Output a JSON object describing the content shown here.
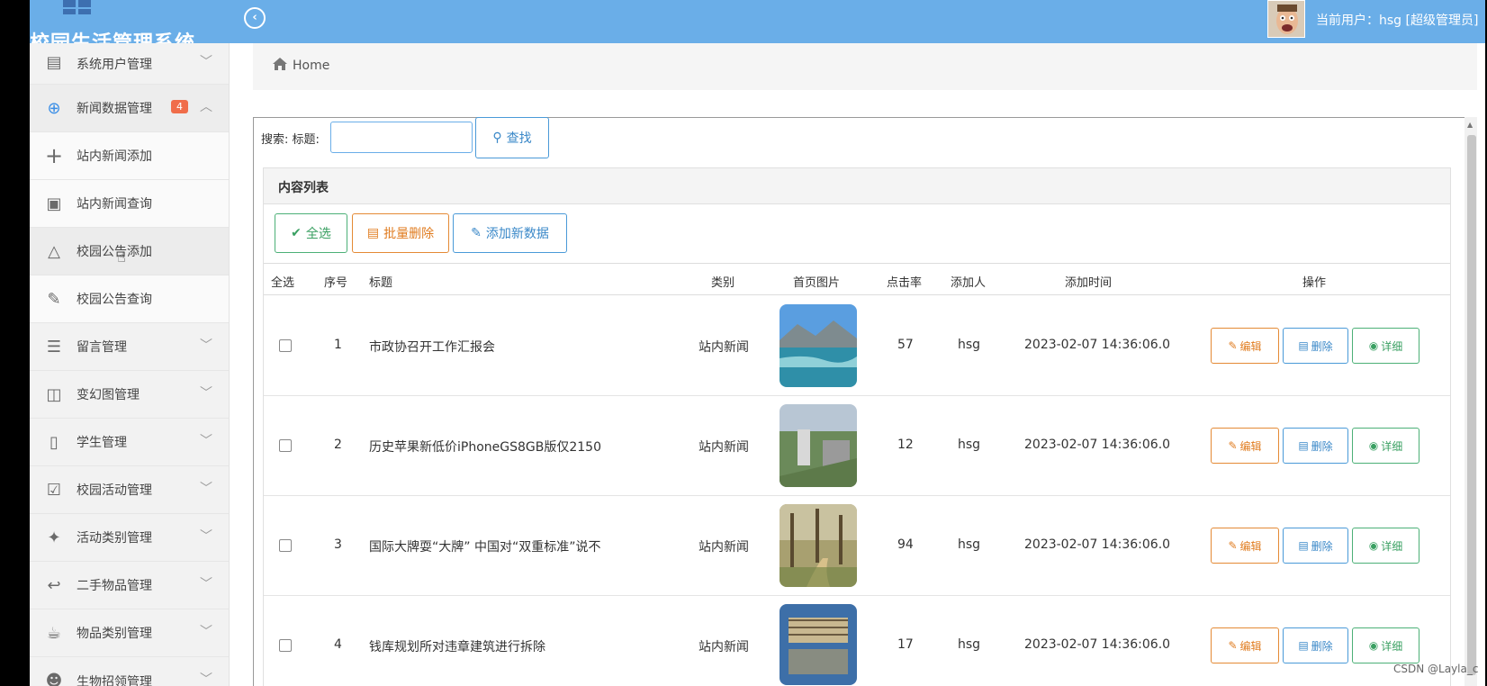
{
  "app": {
    "brand": "校园生活管理系统",
    "user_label": "当前用户：hsg [超级管理员]"
  },
  "sidebar": {
    "items": [
      {
        "label": "系统用户管理",
        "icon": "monitor-icon",
        "chevron": "﹀"
      },
      {
        "label": "新闻数据管理",
        "icon": "crosshair-icon",
        "badge": "4",
        "chevron": "︿"
      },
      {
        "label": "站内新闻添加",
        "icon": "plus-icon"
      },
      {
        "label": "站内新闻查询",
        "icon": "image-icon"
      },
      {
        "label": "校园公告添加",
        "icon": "warning-icon"
      },
      {
        "label": "校园公告查询",
        "icon": "pen-icon"
      },
      {
        "label": "留言管理",
        "icon": "list-icon",
        "chevron": "﹀"
      },
      {
        "label": "变幻图管理",
        "icon": "gift-icon",
        "chevron": "﹀"
      },
      {
        "label": "学生管理",
        "icon": "map-icon",
        "chevron": "﹀"
      },
      {
        "label": "校园活动管理",
        "icon": "checkbox-icon",
        "chevron": "﹀"
      },
      {
        "label": "活动类别管理",
        "icon": "magic-icon",
        "chevron": "﹀"
      },
      {
        "label": "二手物品管理",
        "icon": "reply-icon",
        "chevron": "﹀"
      },
      {
        "label": "物品类别管理",
        "icon": "cup-icon",
        "chevron": "﹀"
      },
      {
        "label": "生物招领管理",
        "icon": "users-icon",
        "chevron": "﹀"
      }
    ]
  },
  "breadcrumb": {
    "home": "Home"
  },
  "search": {
    "label": "搜索: 标题:",
    "value": "",
    "button": "查找"
  },
  "panel": {
    "title": "内容列表"
  },
  "toolbar": {
    "select_all": "全选",
    "batch_delete": "批量删除",
    "add_new": "添加新数据"
  },
  "table": {
    "headers": [
      "全选",
      "序号",
      "标题",
      "类别",
      "首页图片",
      "点击率",
      "添加人",
      "添加时间",
      "操作"
    ],
    "rows": [
      {
        "no": "1",
        "title": "市政协召开工作汇报会",
        "category": "站内新闻",
        "clicks": "57",
        "author": "hsg",
        "time": "2023-02-07 14:36:06.0"
      },
      {
        "no": "2",
        "title": "历史苹果新低价iPhoneGS8GB版仅2150",
        "category": "站内新闻",
        "clicks": "12",
        "author": "hsg",
        "time": "2023-02-07 14:36:06.0"
      },
      {
        "no": "3",
        "title": "国际大牌耍“大牌” 中国对“双重标准”说不",
        "category": "站内新闻",
        "clicks": "94",
        "author": "hsg",
        "time": "2023-02-07 14:36:06.0"
      },
      {
        "no": "4",
        "title": "钱库规划所对违章建筑进行拆除",
        "category": "站内新闻",
        "clicks": "17",
        "author": "hsg",
        "time": "2023-02-07 14:36:06.0"
      }
    ],
    "actions": {
      "edit": "编辑",
      "delete": "删除",
      "detail": "详细"
    }
  },
  "watermark": "CSDN @Layla_c",
  "colors": {
    "topbar": "#6aaee8",
    "edit": "#e48a35",
    "delete": "#4a9ad8",
    "detail": "#4cb077",
    "badge": "#f06d4a"
  }
}
